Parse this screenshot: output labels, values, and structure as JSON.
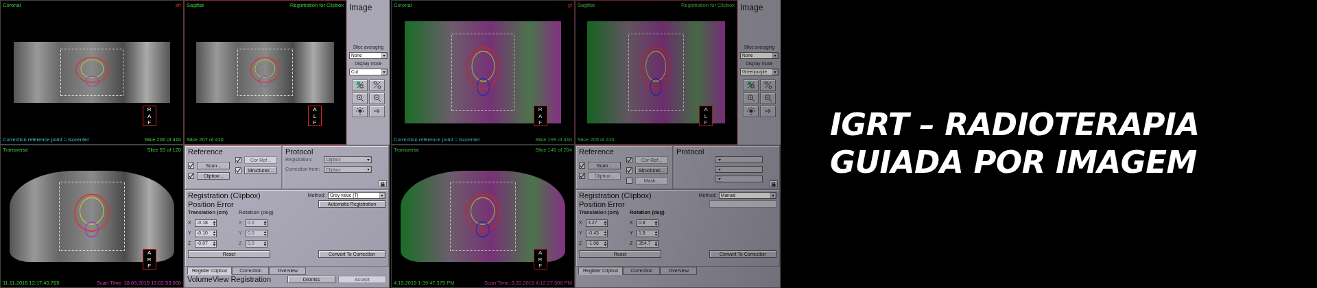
{
  "screens": [
    {
      "kind": "cut",
      "dimmed": false,
      "views": [
        {
          "title": "Coronal",
          "tag": "sfr",
          "footer_left": "Correction reference point = isocenter",
          "footer_right": "Slice 206 of 410",
          "orient": [
            "R",
            "A",
            "F"
          ]
        },
        {
          "title": "Sagittal",
          "tag": "Registration for Clipbox",
          "footer_left": "Slice 207 of 410",
          "orient": [
            "A",
            "L",
            "F"
          ]
        }
      ],
      "image_panel": {
        "title": "Image",
        "controls": [
          {
            "label": "Slice averaging",
            "value": "None"
          },
          {
            "label": "Display mode",
            "value": "Cut"
          }
        ]
      },
      "transverse": {
        "title": "Transverse",
        "tag": "Slice 53 of 120",
        "footer_left": "11.11.2015 12:17:40.765",
        "footer_right": "Scan Time: 18.09.2015 13:02:53.000",
        "orient": [
          "A",
          "R",
          "F"
        ]
      },
      "controls": {
        "reference": {
          "title": "Reference",
          "columns": [
            [
              {
                "label": "Scan ..",
                "checked": true,
                "disabled": false
              },
              {
                "label": "Clipbox ..",
                "checked": true,
                "disabled": false
              }
            ],
            [
              {
                "label": "Cor Ref ..",
                "checked": true,
                "disabled": true
              },
              {
                "label": "Structures ..",
                "checked": true,
                "disabled": false
              }
            ]
          ]
        },
        "protocol": {
          "title": "Protocol",
          "fields": [
            {
              "label": "Registration:",
              "value": "Clipbox",
              "disabled": true
            },
            {
              "label": "Correction from:",
              "value": "Clipbox",
              "disabled": true
            }
          ]
        },
        "registration": {
          "title": "Registration (Clipbox)",
          "method_label": "Method:",
          "method": "Grey value (T)",
          "auto_button": {
            "label": "Automatic Registration",
            "disabled": false
          },
          "position_title": "Position Error",
          "translation_label": "Translation (cm)",
          "rotation_label": "Rotation (deg)",
          "rotation_disabled": true,
          "axes": [
            {
              "axis": "X",
              "translation": "-0.18",
              "rotation_axis": "X",
              "rotation": "0.0"
            },
            {
              "axis": "Y",
              "translation": "-0.10",
              "rotation_axis": "Y",
              "rotation": "0.0"
            },
            {
              "axis": "Z",
              "translation": "-0.07",
              "rotation_axis": "Z",
              "rotation": "0.0"
            }
          ],
          "reset": "Reset",
          "convert": "Convert To Correction"
        },
        "tabs": [
          {
            "label": "Register Clipbox",
            "selected": true
          },
          {
            "label": "Correction",
            "selected": false
          },
          {
            "label": "Overview",
            "selected": false
          }
        ],
        "footer": {
          "title": "VolumeView Registration",
          "buttons": [
            {
              "label": "Dismiss",
              "disabled": false
            },
            {
              "label": "Accept",
              "disabled": true
            }
          ]
        }
      }
    },
    {
      "kind": "fusion",
      "dimmed": true,
      "views": [
        {
          "title": "Coronal",
          "tag": "gt",
          "footer_left": "Correction reference point = isocenter",
          "footer_right": "Slice 199 of 410",
          "orient": [
            "R",
            "A",
            "F"
          ]
        },
        {
          "title": "Sagittal",
          "tag": "Registration for Clipbox",
          "footer_left": "Slice 205 of 410",
          "orient": [
            "A",
            "L",
            "F"
          ]
        }
      ],
      "image_panel": {
        "title": "Image",
        "controls": [
          {
            "label": "Slice averaging",
            "value": "None"
          },
          {
            "label": "Display mode",
            "value": "Greenpurple"
          }
        ]
      },
      "transverse": {
        "title": "Transverse",
        "tag": "Slice 146 of 264",
        "footer_left": "4.15.2015 1:39:47.375 PM",
        "footer_right": "Scan Time: 3.20.2015 4:12:27.000 PM",
        "orient": [
          "A",
          "R",
          "F"
        ]
      },
      "controls": {
        "reference": {
          "title": "Reference",
          "columns": [
            [
              {
                "label": "Scan ..",
                "checked": true,
                "disabled": false
              },
              {
                "label": "Clipbox ..",
                "checked": true,
                "disabled": true
              }
            ],
            [
              {
                "label": "Cor Ref ..",
                "checked": true,
                "disabled": true
              },
              {
                "label": "Structures ..",
                "checked": true,
                "disabled": false
              },
              {
                "label": "Mask ..",
                "checked": false,
                "disabled": true
              }
            ]
          ]
        },
        "protocol": {
          "title": "Protocol",
          "fields": [
            {
              "disabled": true
            },
            {
              "disabled": true
            },
            {
              "disabled": true
            }
          ]
        },
        "registration": {
          "title": "Registration (Clipbox)",
          "method_label": "Method:",
          "method": "Manual",
          "auto_button": {
            "disabled": true
          },
          "position_title": "Position Error",
          "translation_label": "Translation (cm)",
          "rotation_label": "Rotation (deg)",
          "rotation_disabled": false,
          "axes": [
            {
              "axis": "X",
              "translation": "3.27",
              "rotation_axis": "X",
              "rotation": "0.8"
            },
            {
              "axis": "Y",
              "translation": "-0.43",
              "rotation_axis": "Y",
              "rotation": "1.8"
            },
            {
              "axis": "Z",
              "translation": "-1.06",
              "rotation_axis": "Z",
              "rotation": "354.7"
            }
          ],
          "reset": "Reset",
          "convert": "Convert To Correction"
        },
        "tabs": [
          {
            "label": "Register Clipbox",
            "selected": true
          },
          {
            "label": "Correction",
            "selected": false
          },
          {
            "label": "Overview",
            "selected": false
          }
        ]
      }
    }
  ],
  "headline": [
    "IGRT – RADIOTERAPIA",
    "GUIADA POR IMAGEM"
  ]
}
